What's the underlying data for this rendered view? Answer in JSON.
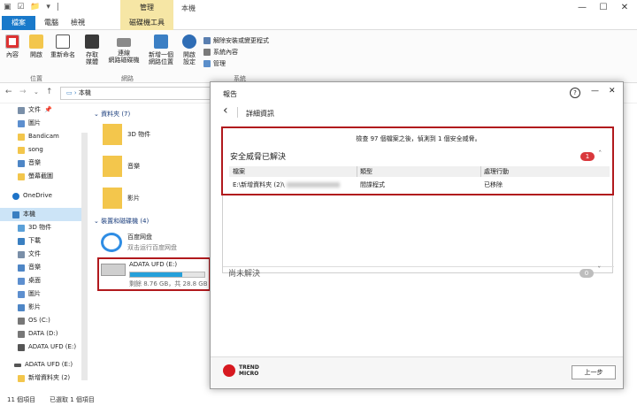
{
  "explorer": {
    "context_tab": "管理",
    "window_title": "本機",
    "window_controls": {
      "minimize": "—",
      "maximize": "☐",
      "close": "✕"
    },
    "tabs": {
      "file": "檔案",
      "computer": "電腦",
      "view": "檢視",
      "drive_tools": "磁碟機工具"
    },
    "ribbon": {
      "properties": "內容",
      "open": "開啟",
      "rename": "重新命名",
      "access_media": "存取\n媒體",
      "map_network_drive": "連線\n網路磁碟機",
      "add_network_location": "新增一個\n網路位置",
      "open_settings": "開啟\n設定",
      "uninstall": "解除安裝或變更程式",
      "system_properties": "系統內容",
      "manage": "管理",
      "group_location": "位置",
      "group_network": "網路",
      "group_system": "系統"
    },
    "address": {
      "text": "本機"
    },
    "nav": {
      "quick": [
        "文件",
        "圖片",
        "Bandicam",
        "song",
        "音樂",
        "螢幕截圖"
      ],
      "onedrive": "OneDrive",
      "this_pc": "本機",
      "pc_items": [
        "3D 物件",
        "下載",
        "文件",
        "音樂",
        "桌面",
        "圖片",
        "影片",
        "OS (C:)",
        "DATA (D:)",
        "ADATA UFD (E:)"
      ],
      "adata": "ADATA UFD (E:)",
      "new_folder": "新增資料夾 (2)"
    },
    "content": {
      "folders_header": "資料夾 (7)",
      "folders": [
        "3D 物件",
        "音樂",
        "影片"
      ],
      "devices_header": "裝置和磁碟機 (4)",
      "baidu_name": "百度网盘",
      "baidu_sub": "双击运行百度网盘",
      "drive_name": "ADATA UFD (E:)",
      "drive_free": "剩餘 8.76 GB，共 28.8 GB",
      "drive_used_fraction": 0.7
    },
    "status": {
      "items": "11 個項目",
      "selected": "已選取 1 個項目"
    }
  },
  "dialog": {
    "title": "報告",
    "help": "?",
    "minimize": "—",
    "close": "✕",
    "back_arrow": "‹",
    "subtitle": "詳細資訊",
    "scan_line": "檢查 97 個檔案之後，偵測到 1 個安全威脅。",
    "resolved_label": "安全威脅已解決",
    "resolved_count": "1",
    "table_headers": [
      "檔案",
      "類型",
      "處理行動"
    ],
    "row": {
      "file": "E:\\新增資料夾 (2)\\",
      "type": "間諜程式",
      "action": "已移除"
    },
    "unresolved_label": "尚未解決",
    "unresolved_count": "0",
    "logo_text_1": "TREND",
    "logo_text_2": "MICRO",
    "back_button": "上一步"
  },
  "colors": {
    "accent": "#1979ca",
    "highlight": "#b1191d",
    "badge_red": "#d9383c",
    "badge_grey": "#bdbdbd",
    "drive_fill": "#26a0da",
    "context_tab": "#f6e6a5"
  }
}
